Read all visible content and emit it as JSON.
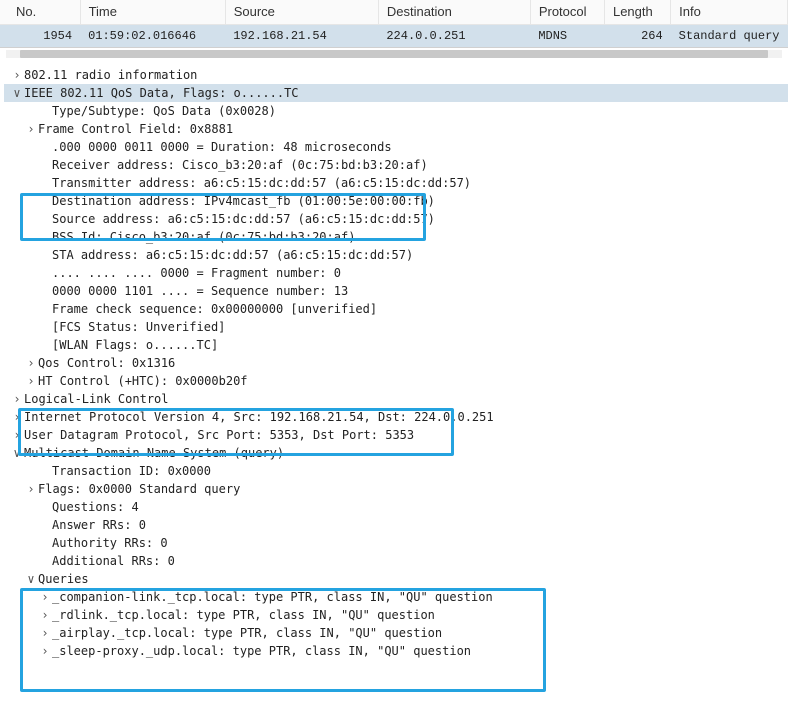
{
  "columns": {
    "no": "No.",
    "time": "Time",
    "source": "Source",
    "destination": "Destination",
    "protocol": "Protocol",
    "length": "Length",
    "info": "Info"
  },
  "packet": {
    "no": "1954",
    "time": "01:59:02.016646",
    "source": "192.168.21.54",
    "destination": "224.0.0.251",
    "protocol": "MDNS",
    "length": "264",
    "info": "Standard query"
  },
  "tree": {
    "radio_info": "802.11 radio information",
    "ieee_hdr": "IEEE 802.11 QoS Data, Flags: o......TC",
    "ieee": {
      "type_subtype": "Type/Subtype: QoS Data (0x0028)",
      "fcf": "Frame Control Field: 0x8881",
      "duration": ".000 0000 0011 0000 = Duration: 48 microseconds",
      "receiver": "Receiver address: Cisco_b3:20:af (0c:75:bd:b3:20:af)",
      "transmitter": "Transmitter address: a6:c5:15:dc:dd:57 (a6:c5:15:dc:dd:57)",
      "destination": "Destination address: IPv4mcast_fb (01:00:5e:00:00:fb)",
      "source": "Source address: a6:c5:15:dc:dd:57 (a6:c5:15:dc:dd:57)",
      "bssid": "BSS Id: Cisco_b3:20:af (0c:75:bd:b3:20:af)",
      "sta": "STA address: a6:c5:15:dc:dd:57 (a6:c5:15:dc:dd:57)",
      "frag": ".... .... .... 0000 = Fragment number: 0",
      "seq": "0000 0000 1101 .... = Sequence number: 13",
      "fcs": "Frame check sequence: 0x00000000 [unverified]",
      "fcs_status": "[FCS Status: Unverified]",
      "wlan_flags": "[WLAN Flags: o......TC]",
      "qos": "Qos Control: 0x1316",
      "ht": "HT Control (+HTC): 0x0000b20f"
    },
    "llc": "Logical-Link Control",
    "ipv4": "Internet Protocol Version 4, Src: 192.168.21.54, Dst: 224.0.0.251",
    "udp": "User Datagram Protocol, Src Port: 5353, Dst Port: 5353",
    "mdns_hdr": "Multicast Domain Name System (query)",
    "mdns": {
      "txid": "Transaction ID: 0x0000",
      "flags": "Flags: 0x0000 Standard query",
      "questions": "Questions: 4",
      "answers": "Answer RRs: 0",
      "authority": "Authority RRs: 0",
      "additional": "Additional RRs: 0",
      "queries_hdr": "Queries",
      "queries": {
        "q0": "_companion-link._tcp.local: type PTR, class IN, \"QU\" question",
        "q1": "_rdlink._tcp.local: type PTR, class IN, \"QU\" question",
        "q2": "_airplay._tcp.local: type PTR, class IN, \"QU\" question",
        "q3": "_sleep-proxy._udp.local: type PTR, class IN, \"QU\" question"
      }
    }
  }
}
